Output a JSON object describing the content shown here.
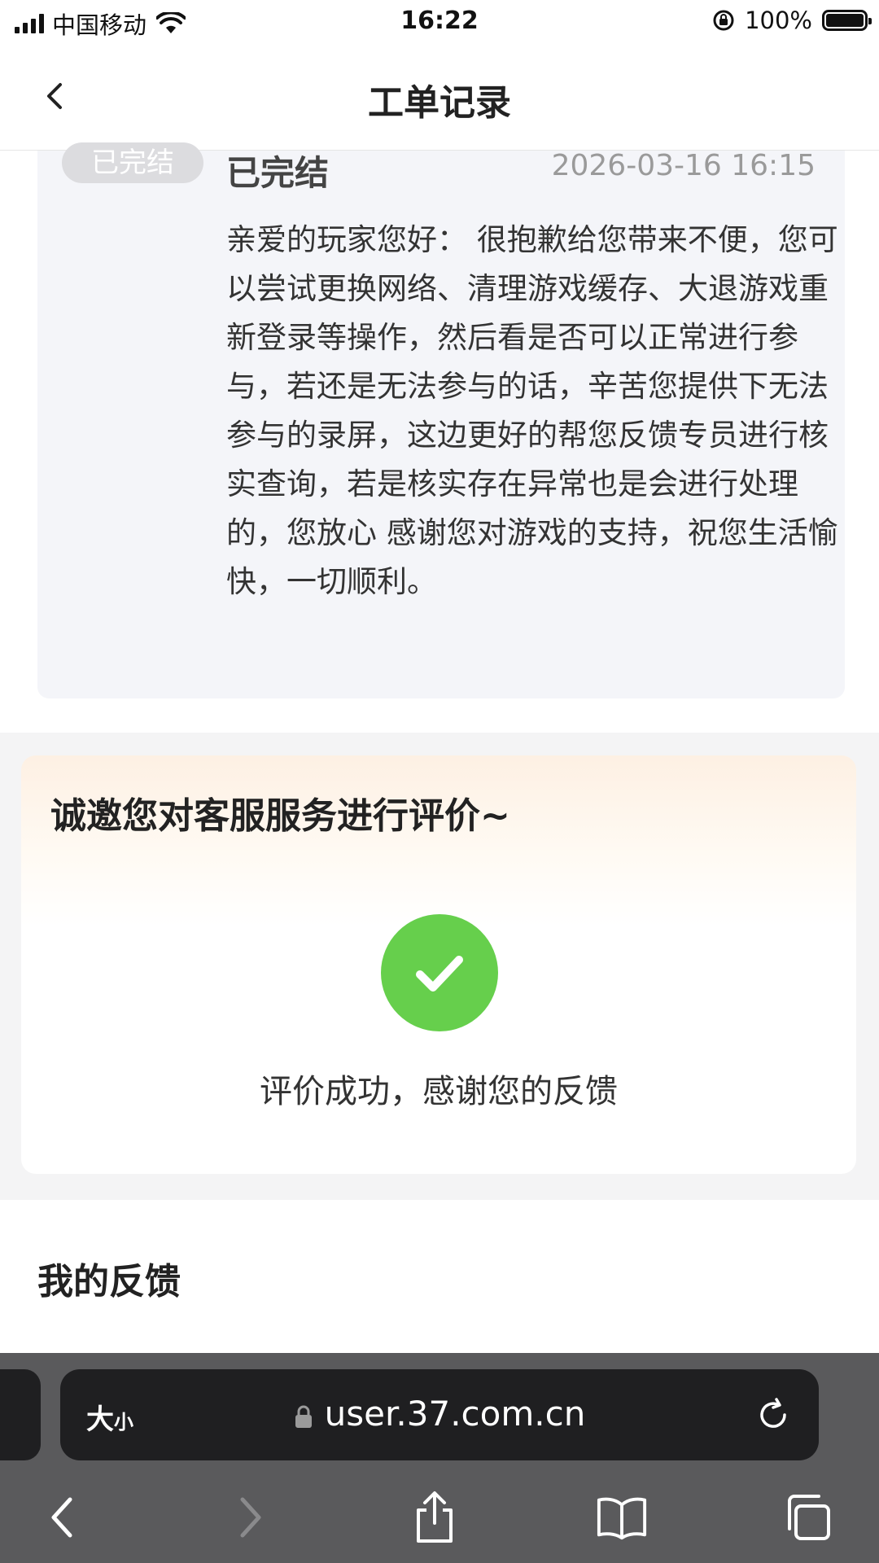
{
  "status_bar": {
    "carrier": "中国移动",
    "time": "16:22",
    "battery": "100%"
  },
  "nav": {
    "title": "工单记录"
  },
  "reply": {
    "badge": "已完结",
    "status": "已完结",
    "time": "2026-03-16 16:15",
    "body": "亲爱的玩家您好： 很抱歉给您带来不便，您可以尝试更换网络、清理游戏缓存、大退游戏重新登录等操作，然后看是否可以正常进行参与，若还是无法参与的话，辛苦您提供下无法参与的录屏，这边更好的帮您反馈专员进行核实查询，若是核实存在异常也是会进行处理的，您放心 感谢您对游戏的支持，祝您生活愉快，一切顺利。"
  },
  "rating": {
    "title": "诚邀您对客服服务进行评价~",
    "success_text": "评价成功，感谢您的反馈"
  },
  "feedback": {
    "title": "我的反馈"
  },
  "browser": {
    "text_size_big": "大",
    "text_size_small": "小",
    "url": "user.37.com.cn"
  },
  "icons": {
    "back": "chevron-left-icon",
    "check": "check-icon",
    "lock": "lock-icon",
    "reload": "reload-icon",
    "share": "share-icon",
    "bookmarks": "book-icon",
    "tabs": "tabs-icon"
  },
  "colors": {
    "success": "#66cf4c",
    "badge": "#dcdcdf",
    "browser_bar": "#5a5a5c"
  }
}
